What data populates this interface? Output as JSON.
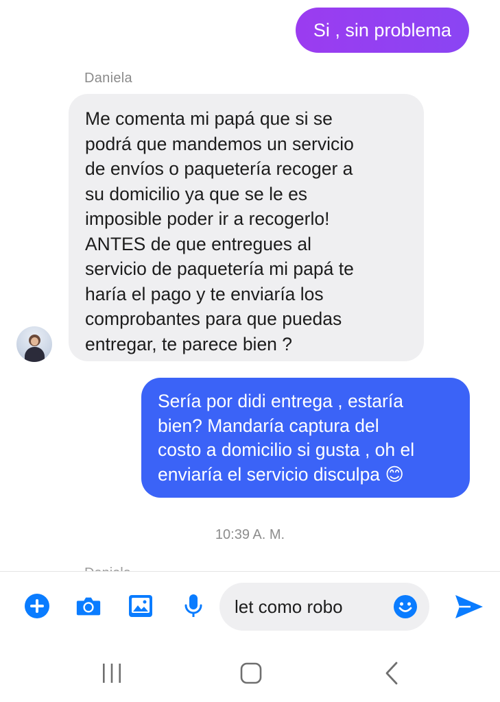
{
  "conversation": {
    "messages": [
      {
        "id": "m1",
        "direction": "outgoing",
        "text": "Si , sin problema"
      },
      {
        "id": "m2",
        "direction": "incoming",
        "sender": "Daniela",
        "text": "Me comenta mi papá que si se\npodrá que mandemos un servicio\nde envíos o paquetería  recoger a\nsu domicilio ya que se le es\nimposible poder ir a recogerlo!\nANTES de que entregues al\nservicio de paquetería mi papá te\nharía el pago y te enviaría los\ncomprobantes para que puedas\nentregar, te parece bien ?"
      },
      {
        "id": "m3",
        "direction": "outgoing",
        "text": "Sería por didi entrega , estaría\nbien? Mandaría captura del\ncosto a domicilio si gusta , oh el\nenviaría el servicio disculpa 😊"
      }
    ],
    "timestamp": "10:39 A. M.",
    "partial_sender": "Daniela"
  },
  "composer": {
    "input_value": "let como robo",
    "icons": {
      "add": "plus-circle-icon",
      "camera": "camera-icon",
      "gallery": "image-icon",
      "voice": "microphone-icon",
      "emoji": "emoji-icon",
      "send": "send-icon"
    }
  },
  "navigation": {
    "icons": {
      "recents": "recents-icon",
      "home": "home-icon",
      "back": "back-icon"
    }
  },
  "colors": {
    "accent": "#0a7cff",
    "outgoing_purple": "#9b3cf0",
    "outgoing_blue": "#3b63f7",
    "incoming_bg": "#efeff1"
  }
}
